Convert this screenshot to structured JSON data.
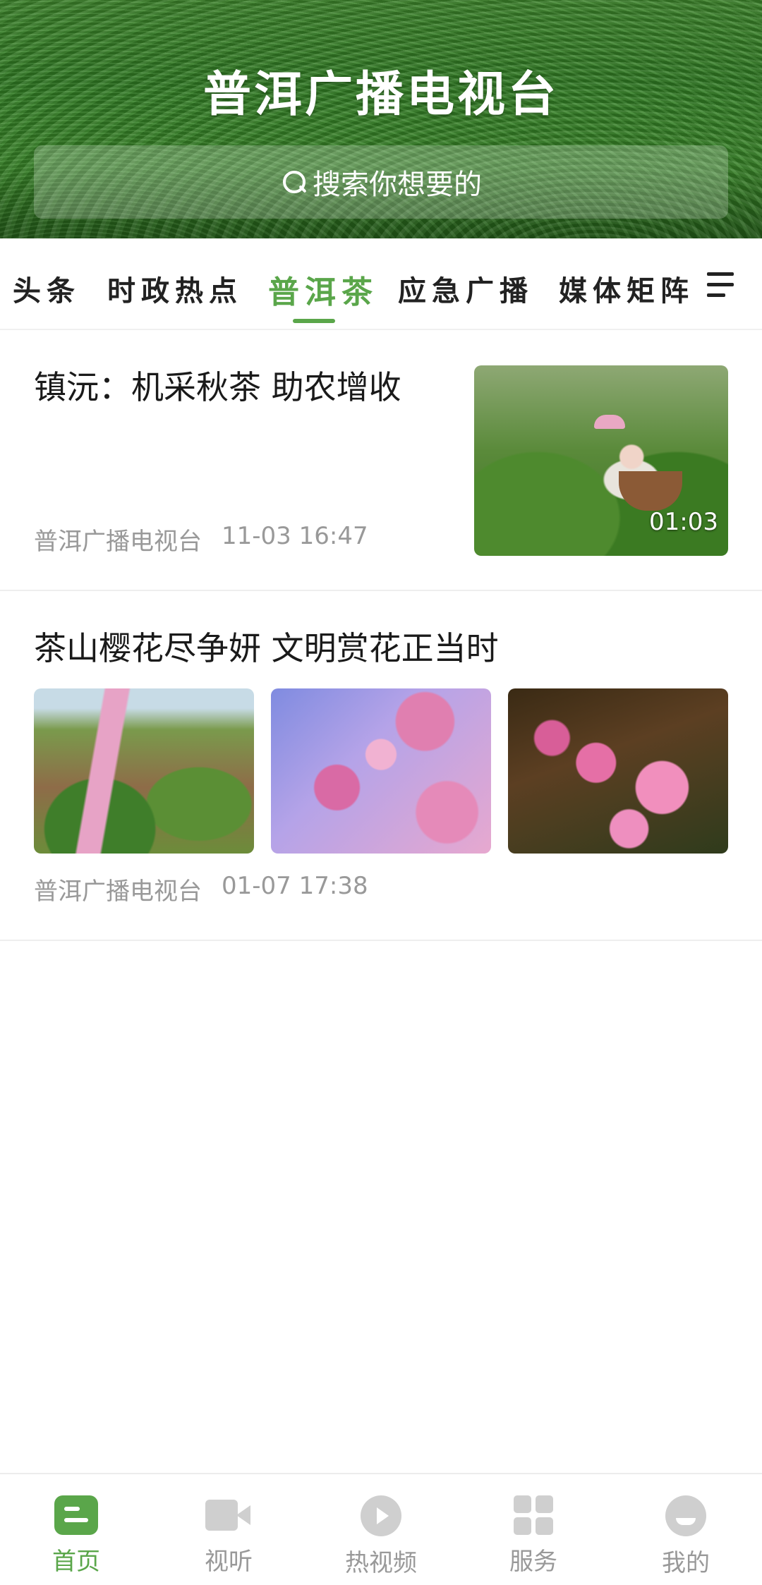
{
  "header": {
    "title": "普洱广播电视台",
    "search_placeholder": "搜索你想要的"
  },
  "tabs": [
    {
      "label": "头条",
      "active": false
    },
    {
      "label": "时政热点",
      "active": false
    },
    {
      "label": "普洱茶",
      "active": true
    },
    {
      "label": "应急广播",
      "active": false
    },
    {
      "label": "媒体矩阵",
      "active": false
    }
  ],
  "articles": [
    {
      "title": "镇沅：机采秋茶 助农增收",
      "source": "普洱广播电视台",
      "time": "11-03 16:47",
      "video_duration": "01:03"
    },
    {
      "title": "茶山樱花尽争妍 文明赏花正当时",
      "source": "普洱广播电视台",
      "time": "01-07 17:38"
    }
  ],
  "bottom_nav": [
    {
      "label": "首页",
      "icon": "home-icon",
      "active": true
    },
    {
      "label": "视听",
      "icon": "video-camera-icon",
      "active": false
    },
    {
      "label": "热视频",
      "icon": "play-icon",
      "active": false
    },
    {
      "label": "服务",
      "icon": "grid-icon",
      "active": false
    },
    {
      "label": "我的",
      "icon": "user-icon",
      "active": false
    }
  ],
  "colors": {
    "accent": "#5aa64a",
    "inactive": "#999999"
  }
}
